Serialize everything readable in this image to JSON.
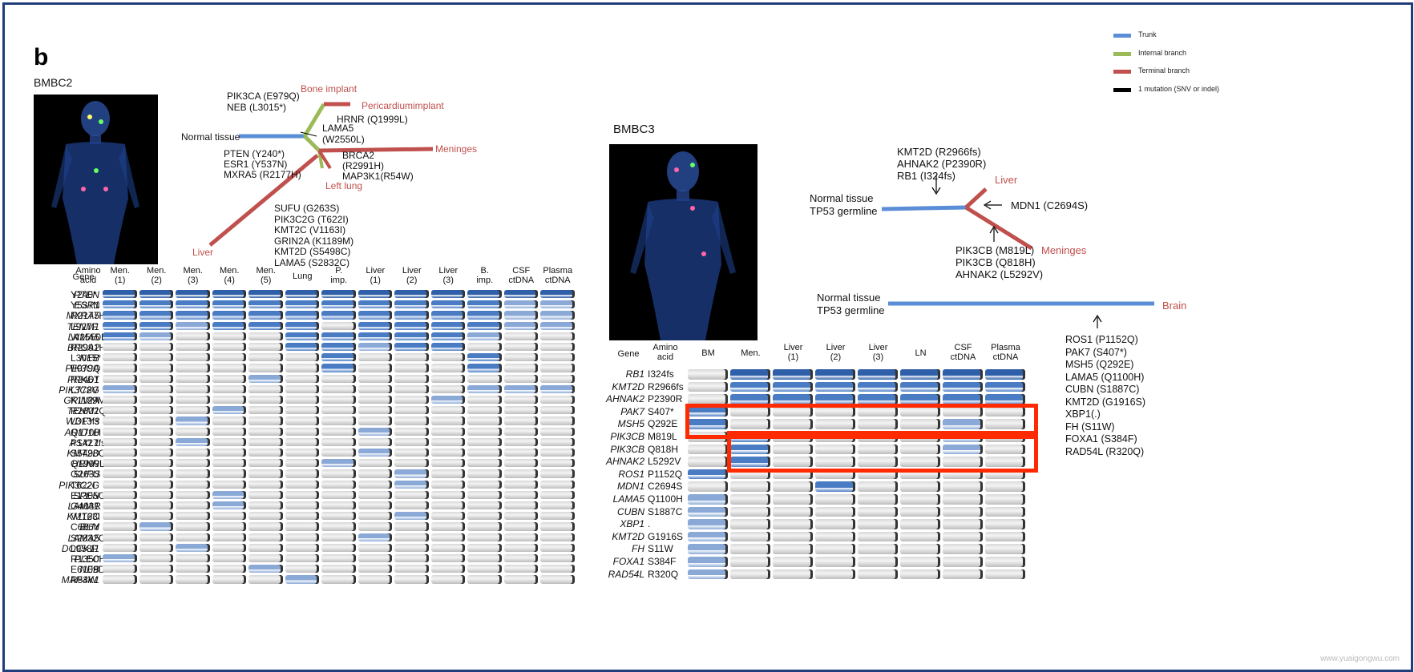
{
  "panel_label": "b",
  "watermark": "www.yuaigongwu.com",
  "legend": {
    "items": [
      {
        "label": "Trunk",
        "color": "#5b8ed6"
      },
      {
        "label": "Internal branch",
        "color": "#9bbb59"
      },
      {
        "label": "Terminal branch",
        "color": "#c0504d"
      },
      {
        "label": "1 mutation (SNV or indel)",
        "color": "#000000"
      }
    ]
  },
  "bmbc2": {
    "title": "BMBC2",
    "tree": {
      "normal": "Normal tissue",
      "bone": "Bone implant",
      "peri": "Pericardiumimplant",
      "meninges": "Meninges",
      "leftlung": "Left lung",
      "liver": "Liver",
      "m_bone": [
        "PIK3CA (E979Q)",
        "NEB (L3015*)"
      ],
      "m_peri": [
        "HRNR (Q1999L)"
      ],
      "m_lama": [
        "LAMA5",
        "(W2550L)"
      ],
      "m_trunk": [
        "PTEN (Y240*)",
        "ESR1 (Y537N)",
        "MXRA5 (R2177H)"
      ],
      "m_brca": [
        "BRCA2",
        "(R2991H)",
        "MAP3K1(R54W)"
      ],
      "m_liver": [
        "SUFU (G263S)",
        "PIK3C2G (T622I)",
        "KMT2C (V1163I)",
        "GRIN2A (K1189M)",
        "KMT2D (S5498C)",
        "LAMA5 (S2832C)"
      ]
    },
    "table": {
      "gene_header": "Gene",
      "aa_header": [
        "Amino",
        "acid"
      ],
      "columns": [
        [
          "Men.",
          "(1)"
        ],
        [
          "Men.",
          "(2)"
        ],
        [
          "Men.",
          "(3)"
        ],
        [
          "Men.",
          "(4)"
        ],
        [
          "Men.",
          "(5)"
        ],
        [
          "Lung",
          ""
        ],
        [
          "P.",
          "imp."
        ],
        [
          "Liver",
          "(1)"
        ],
        [
          "Liver",
          "(2)"
        ],
        [
          "Liver",
          "(3)"
        ],
        [
          "B.",
          "imp."
        ],
        [
          "CSF",
          "ctDNA"
        ],
        [
          "Plasma",
          "ctDNA"
        ]
      ],
      "rows": [
        {
          "gene": "PTEN",
          "aa": "Y240*",
          "cells": [
            3,
            3,
            3,
            3,
            3,
            3,
            3,
            3,
            3,
            3,
            3,
            3,
            3
          ]
        },
        {
          "gene": "ESR1",
          "aa": "Y537N",
          "cells": [
            2,
            2,
            2,
            2,
            2,
            2,
            2,
            2,
            2,
            2,
            2,
            1,
            1
          ]
        },
        {
          "gene": "MXRA5",
          "aa": "R2177H",
          "cells": [
            2,
            2,
            2,
            2,
            2,
            2,
            2,
            2,
            2,
            2,
            2,
            1,
            1
          ]
        },
        {
          "gene": "TENM1",
          "aa": "L927F",
          "cells": [
            2,
            2,
            1,
            2,
            2,
            2,
            0,
            2,
            2,
            2,
            2,
            1,
            1
          ]
        },
        {
          "gene": "LAMA5",
          "aa": "W2550L",
          "cells": [
            2,
            1,
            0,
            0,
            0,
            2,
            2,
            2,
            2,
            2,
            1,
            0,
            0
          ]
        },
        {
          "gene": "BRCA2",
          "aa": "R2991H",
          "cells": [
            0,
            0,
            0,
            0,
            0,
            2,
            2,
            1,
            2,
            2,
            0,
            0,
            0
          ]
        },
        {
          "gene": "NEB",
          "aa": "L3015*",
          "cells": [
            0,
            0,
            0,
            0,
            0,
            0,
            2,
            0,
            0,
            0,
            2,
            0,
            0
          ]
        },
        {
          "gene": "PIK3CA",
          "aa": "E979Q",
          "cells": [
            0,
            0,
            0,
            0,
            0,
            0,
            2,
            0,
            0,
            0,
            2,
            0,
            0
          ]
        },
        {
          "gene": "PRKD1",
          "aa": "R246T",
          "cells": [
            0,
            0,
            0,
            0,
            1,
            0,
            0,
            0,
            0,
            0,
            0,
            0,
            0
          ]
        },
        {
          "gene": "PIK3C2G",
          "aa": "L778V",
          "cells": [
            1,
            0,
            0,
            0,
            0,
            0,
            0,
            0,
            0,
            0,
            1,
            1,
            1
          ]
        },
        {
          "gene": "GRIN2A",
          "aa": "K1189M",
          "cells": [
            0,
            0,
            0,
            0,
            0,
            0,
            0,
            0,
            0,
            1,
            0,
            0,
            0
          ]
        },
        {
          "gene": "TENM1",
          "aa": "R2602Q",
          "cells": [
            0,
            0,
            0,
            1,
            0,
            0,
            0,
            0,
            0,
            0,
            0,
            0,
            0
          ]
        },
        {
          "gene": "WDFY3",
          "aa": "L313fs",
          "cells": [
            0,
            0,
            1,
            0,
            0,
            0,
            0,
            0,
            0,
            0,
            0,
            0,
            0
          ]
        },
        {
          "gene": "ARID1B",
          "aa": "Q170H",
          "cells": [
            0,
            0,
            0,
            0,
            0,
            0,
            0,
            1,
            0,
            0,
            0,
            0,
            0
          ]
        },
        {
          "gene": "ASXL1",
          "aa": "P1427fs",
          "cells": [
            0,
            0,
            1,
            0,
            0,
            0,
            0,
            0,
            0,
            0,
            0,
            0,
            0
          ]
        },
        {
          "gene": "KMT2D",
          "aa": "S5498C",
          "cells": [
            0,
            0,
            0,
            0,
            0,
            0,
            0,
            1,
            0,
            0,
            0,
            0,
            0
          ]
        },
        {
          "gene": "HRNR",
          "aa": "Q1999L",
          "cells": [
            0,
            0,
            0,
            0,
            0,
            0,
            1,
            0,
            0,
            0,
            0,
            0,
            0
          ]
        },
        {
          "gene": "SUFU",
          "aa": "G263S",
          "cells": [
            0,
            0,
            0,
            0,
            0,
            0,
            0,
            0,
            1,
            0,
            0,
            0,
            0
          ]
        },
        {
          "gene": "PIK3C2G",
          "aa": "T622I",
          "cells": [
            0,
            0,
            0,
            0,
            0,
            0,
            0,
            0,
            1,
            0,
            0,
            0,
            0
          ]
        },
        {
          "gene": "SPEN",
          "aa": "E1305G",
          "cells": [
            0,
            0,
            0,
            1,
            0,
            0,
            0,
            0,
            0,
            0,
            0,
            0,
            0
          ]
        },
        {
          "gene": "LAMA1",
          "aa": "G403R",
          "cells": [
            0,
            0,
            0,
            1,
            0,
            0,
            0,
            0,
            0,
            0,
            0,
            0,
            0
          ]
        },
        {
          "gene": "KMT2C",
          "aa": "V1163I",
          "cells": [
            0,
            0,
            0,
            0,
            0,
            0,
            0,
            0,
            1,
            0,
            0,
            0,
            0
          ]
        },
        {
          "gene": "BLM",
          "aa": "C686Y",
          "cells": [
            0,
            1,
            0,
            0,
            0,
            0,
            0,
            0,
            0,
            0,
            0,
            0,
            0
          ]
        },
        {
          "gene": "LAMA5",
          "aa": "S2832C",
          "cells": [
            0,
            0,
            0,
            0,
            0,
            0,
            0,
            1,
            0,
            0,
            0,
            0,
            0
          ]
        },
        {
          "gene": "DOCK11",
          "aa": "L958P",
          "cells": [
            0,
            0,
            1,
            0,
            0,
            0,
            0,
            0,
            0,
            0,
            0,
            0,
            0
          ]
        },
        {
          "gene": "PLEC",
          "aa": "R1350H",
          "cells": [
            1,
            0,
            0,
            0,
            0,
            0,
            0,
            0,
            0,
            0,
            0,
            0,
            0
          ]
        },
        {
          "gene": "NEB",
          "aa": "E6109D",
          "cells": [
            0,
            0,
            0,
            0,
            1,
            0,
            0,
            0,
            0,
            0,
            0,
            0,
            0
          ]
        },
        {
          "gene": "MAP3K1",
          "aa": "R54W",
          "cells": [
            0,
            0,
            0,
            0,
            0,
            1,
            0,
            0,
            0,
            0,
            0,
            0,
            0
          ]
        }
      ]
    }
  },
  "bmbc3": {
    "title": "BMBC3",
    "tree": {
      "normal": [
        "Normal tissue",
        "TP53 germline"
      ],
      "liver": "Liver",
      "meninges": "Meninges",
      "m_trunk": [
        "KMT2D (R2966fs)",
        "AHNAK2 (P2390R)",
        "RB1 (I324fs)"
      ],
      "m_liver": [
        "MDN1 (C2694S)"
      ],
      "m_men": [
        "PIK3CB (M819L)",
        "PIK3CB (Q818H)",
        "AHNAK2 (L5292V)"
      ],
      "normal2": [
        "Normal tissue",
        "TP53 germline"
      ],
      "brain": "Brain",
      "m_brain": [
        "ROS1 (P1152Q)",
        "PAK7 (S407*)",
        "MSH5 (Q292E)",
        "LAMA5 (Q1100H)",
        "CUBN (S1887C)",
        "KMT2D (G1916S)",
        "XBP1(.)",
        "FH (S11W)",
        "FOXA1 (S384F)",
        "RAD54L (R320Q)"
      ]
    },
    "table": {
      "gene_header": "Gene",
      "aa_header": [
        "Amino",
        "acid"
      ],
      "columns": [
        [
          "BM",
          ""
        ],
        [
          "Men.",
          ""
        ],
        [
          "Liver",
          "(1)"
        ],
        [
          "Liver",
          "(2)"
        ],
        [
          "Liver",
          "(3)"
        ],
        [
          "LN",
          ""
        ],
        [
          "CSF",
          "ctDNA"
        ],
        [
          "Plasma",
          "ctDNA"
        ]
      ],
      "rows": [
        {
          "gene": "RB1",
          "aa": "I324fs",
          "cells": [
            0,
            3,
            3,
            3,
            3,
            3,
            3,
            3
          ]
        },
        {
          "gene": "KMT2D",
          "aa": "R2966fs",
          "cells": [
            0,
            2,
            2,
            2,
            2,
            2,
            2,
            2
          ]
        },
        {
          "gene": "AHNAK2",
          "aa": "P2390R",
          "cells": [
            0,
            2,
            2,
            2,
            2,
            2,
            2,
            2
          ]
        },
        {
          "gene": "PAK7",
          "aa": "S407*",
          "cells": [
            2,
            0,
            0,
            0,
            0,
            0,
            0,
            0
          ]
        },
        {
          "gene": "MSH5",
          "aa": "Q292E",
          "cells": [
            2,
            0,
            0,
            0,
            0,
            0,
            1,
            0
          ]
        },
        {
          "gene": "PIK3CB",
          "aa": "M819L",
          "cells": [
            0,
            2,
            0,
            0,
            0,
            0,
            1,
            0
          ]
        },
        {
          "gene": "PIK3CB",
          "aa": "Q818H",
          "cells": [
            0,
            2,
            0,
            0,
            0,
            0,
            1,
            0
          ]
        },
        {
          "gene": "AHNAK2",
          "aa": "L5292V",
          "cells": [
            0,
            2,
            0,
            0,
            0,
            0,
            0,
            0
          ]
        },
        {
          "gene": "ROS1",
          "aa": "P1152Q",
          "cells": [
            2,
            0,
            0,
            0,
            0,
            0,
            0,
            0
          ]
        },
        {
          "gene": "MDN1",
          "aa": "C2694S",
          "cells": [
            0,
            0,
            0,
            2,
            0,
            0,
            0,
            0
          ]
        },
        {
          "gene": "LAMA5",
          "aa": "Q1100H",
          "cells": [
            1,
            0,
            0,
            0,
            0,
            0,
            0,
            0
          ]
        },
        {
          "gene": "CUBN",
          "aa": "S1887C",
          "cells": [
            1,
            0,
            0,
            0,
            0,
            0,
            0,
            0
          ]
        },
        {
          "gene": "XBP1",
          "aa": ".",
          "cells": [
            1,
            0,
            0,
            0,
            0,
            0,
            0,
            0
          ]
        },
        {
          "gene": "KMT2D",
          "aa": "G1916S",
          "cells": [
            1,
            0,
            0,
            0,
            0,
            0,
            0,
            0
          ]
        },
        {
          "gene": "FH",
          "aa": "S11W",
          "cells": [
            1,
            0,
            0,
            0,
            0,
            0,
            0,
            0
          ]
        },
        {
          "gene": "FOXA1",
          "aa": "S384F",
          "cells": [
            1,
            0,
            0,
            0,
            0,
            0,
            0,
            0
          ]
        },
        {
          "gene": "RAD54L",
          "aa": "R320Q",
          "cells": [
            1,
            0,
            0,
            0,
            0,
            0,
            0,
            0
          ]
        }
      ]
    }
  },
  "cell_colors": [
    "#cfcfcf",
    "#8aa9d6",
    "#4a7cc4",
    "#2e5fa8"
  ],
  "highlight_color": "#ff2a00"
}
